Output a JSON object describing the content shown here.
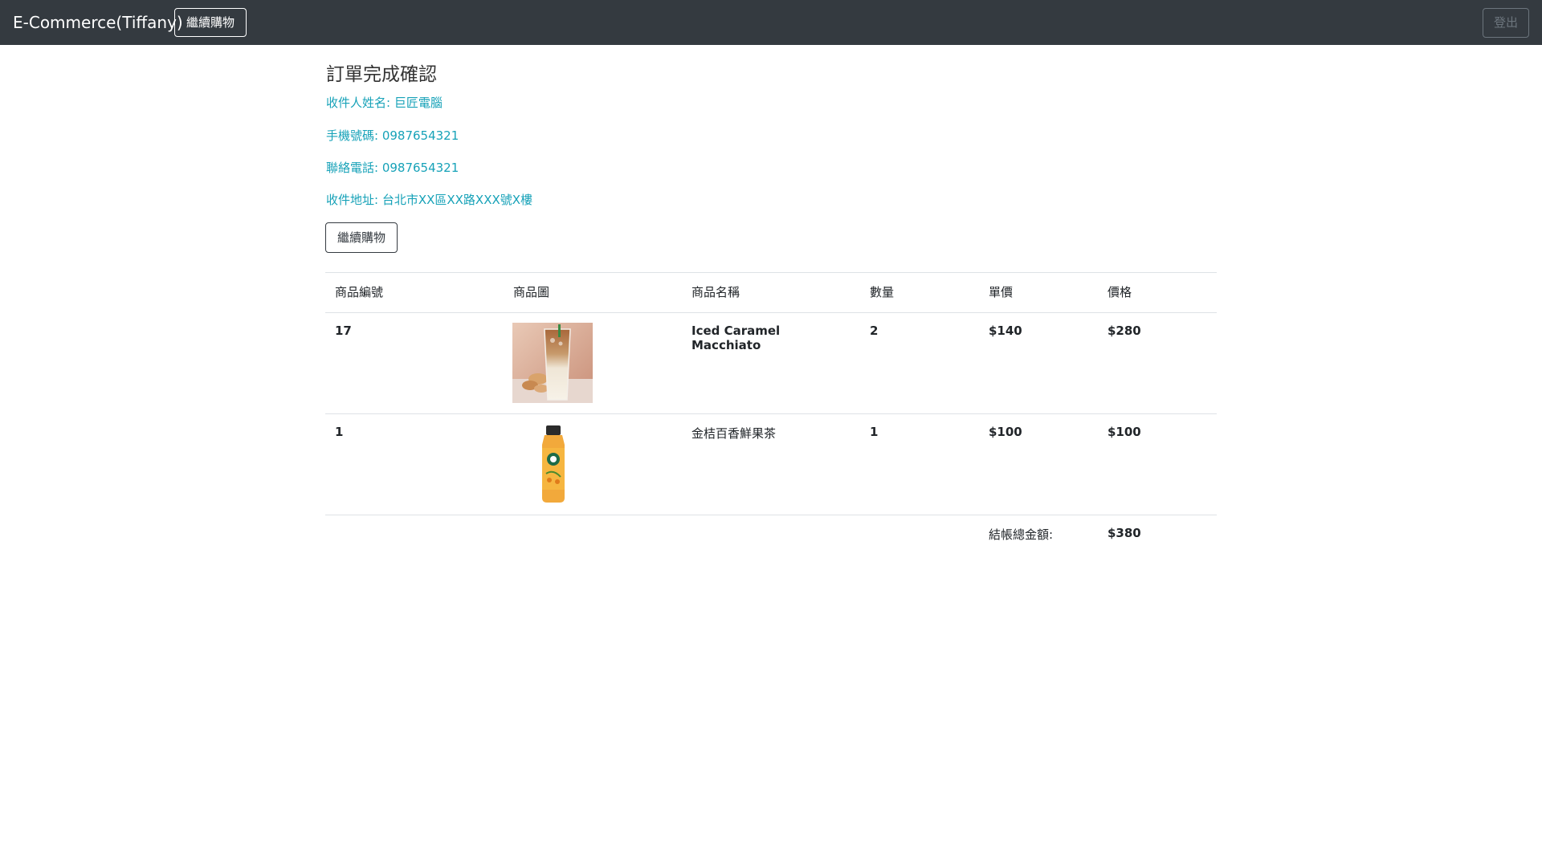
{
  "navbar": {
    "brand": "E-Commerce(Tiffany)",
    "continue_label": "繼續購物",
    "logout_label": "登出"
  },
  "order": {
    "title": "訂單完成確認",
    "recipient_name": "收件人姓名: 巨匠電腦",
    "mobile": "手機號碼: 0987654321",
    "phone": "聯絡電話: 0987654321",
    "address": "收件地址: 台北市XX區XX路XXX號X樓",
    "continue_label": "繼續購物"
  },
  "table": {
    "headers": [
      "商品編號",
      "商品圖",
      "商品名稱",
      "數量",
      "單價",
      "價格"
    ],
    "rows": [
      {
        "id": "17",
        "image_icon": "iced-caramel-macchiato-photo",
        "name": "Iced Caramel Macchiato",
        "qty": "2",
        "unit_price": "$140",
        "price": "$280"
      },
      {
        "id": "1",
        "image_icon": "kumquat-passionfruit-tea-bottle-photo",
        "name": "金桔百香鮮果茶",
        "qty": "1",
        "unit_price": "$100",
        "price": "$100"
      }
    ],
    "total_label": "結帳總金額:",
    "total_value": "$380"
  },
  "colors": {
    "navbar_bg": "#343a40",
    "info_text": "#17a2b8",
    "border": "#dee2e6"
  }
}
